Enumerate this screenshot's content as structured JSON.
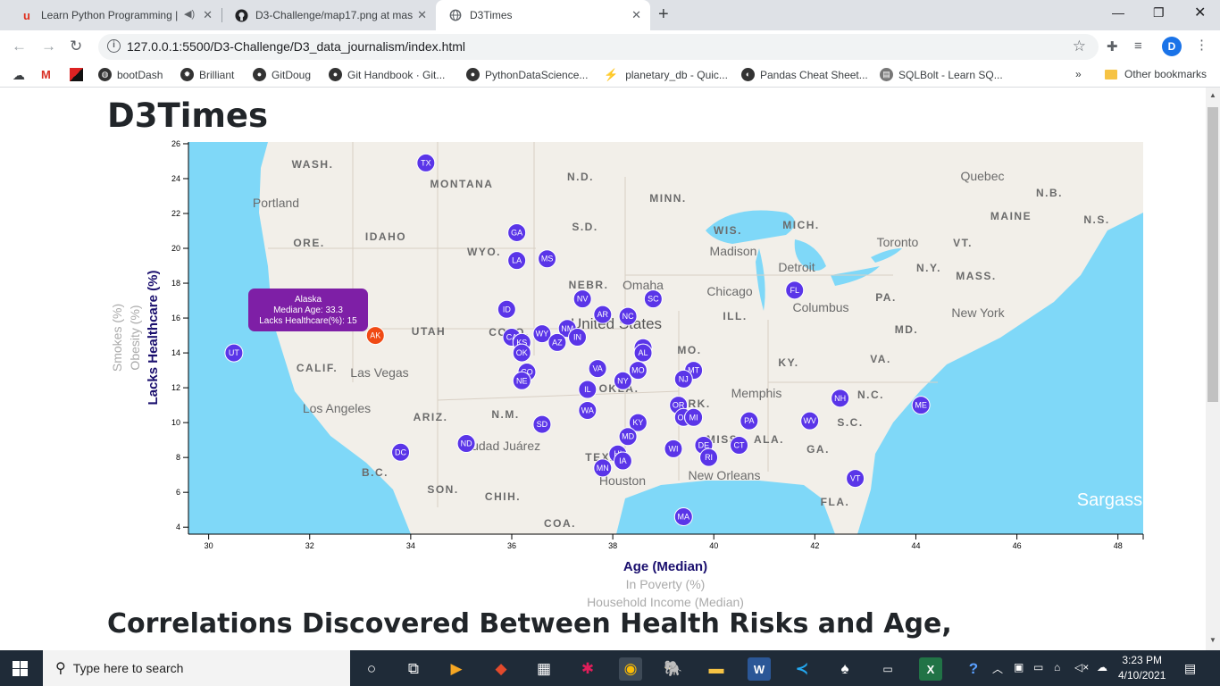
{
  "browser": {
    "tabs": [
      {
        "title": "Learn Python Programming |",
        "icon": "udemy-icon",
        "active": false
      },
      {
        "title": "D3-Challenge/map17.png at mas",
        "icon": "github-icon",
        "active": false
      },
      {
        "title": "D3Times",
        "icon": "globe-icon",
        "active": true
      }
    ],
    "url": "127.0.0.1:5500/D3-Challenge/D3_data_journalism/index.html",
    "profile_initial": "D",
    "bookmarks": [
      "bootDash",
      "Brilliant",
      "GitDoug",
      "Git Handbook · Git...",
      "PythonDataScience...",
      "planetary_db - Quic...",
      "Pandas Cheat Sheet...",
      "SQLBolt - Learn SQ..."
    ],
    "other_bookmarks": "Other bookmarks"
  },
  "page": {
    "title": "D3Times",
    "section_heading": "Correlations Discovered Between Health Risks and Age,"
  },
  "chart_data": {
    "type": "scatter",
    "xlabels": {
      "active": "Age (Median)",
      "inactive": [
        "In Poverty (%)",
        "Household Income (Median)"
      ]
    },
    "ylabels": {
      "active": "Lacks Healthcare (%)",
      "inactive": [
        "Obesity (%)",
        "Smokes (%)"
      ]
    },
    "xlim": [
      29.6,
      48.5
    ],
    "ylim": [
      3.6,
      26.1
    ],
    "xticks": [
      30,
      32,
      34,
      36,
      38,
      40,
      42,
      44,
      46,
      48
    ],
    "yticks": [
      4,
      6,
      8,
      10,
      12,
      14,
      16,
      18,
      20,
      22,
      24,
      26
    ],
    "colors": {
      "point": "#5a35e8",
      "highlight": "#f04a14",
      "tooltip": "#7e1fa6",
      "active_label": "#1a0f6e",
      "inactive_label": "#aaaaaa"
    },
    "points": [
      {
        "abbr": "TX",
        "x": 34.3,
        "y": 24.9
      },
      {
        "abbr": "GA",
        "x": 36.1,
        "y": 20.9
      },
      {
        "abbr": "LA",
        "x": 36.1,
        "y": 19.3
      },
      {
        "abbr": "MS",
        "x": 36.7,
        "y": 19.4
      },
      {
        "abbr": "NV",
        "x": 37.4,
        "y": 17.1
      },
      {
        "abbr": "SC",
        "x": 38.8,
        "y": 17.1
      },
      {
        "abbr": "FL",
        "x": 41.6,
        "y": 17.6
      },
      {
        "abbr": "ID",
        "x": 35.9,
        "y": 16.5
      },
      {
        "abbr": "AR",
        "x": 37.8,
        "y": 16.2
      },
      {
        "abbr": "NC",
        "x": 38.3,
        "y": 16.1
      },
      {
        "abbr": "NM",
        "x": 37.1,
        "y": 15.4
      },
      {
        "abbr": "IN",
        "x": 37.3,
        "y": 14.9
      },
      {
        "abbr": "WY",
        "x": 36.6,
        "y": 15.1
      },
      {
        "abbr": "CA",
        "x": 36.0,
        "y": 14.9
      },
      {
        "abbr": "KS",
        "x": 36.2,
        "y": 14.6
      },
      {
        "abbr": "OK",
        "x": 36.2,
        "y": 14.0
      },
      {
        "abbr": "AZ",
        "x": 36.9,
        "y": 14.6
      },
      {
        "abbr": "TN",
        "x": 38.6,
        "y": 14.3
      },
      {
        "abbr": "AL",
        "x": 38.6,
        "y": 14.0
      },
      {
        "abbr": "UT",
        "x": 30.5,
        "y": 14.0
      },
      {
        "abbr": "AK",
        "x": 33.3,
        "y": 15.0,
        "highlight": true
      },
      {
        "abbr": "VA",
        "x": 37.7,
        "y": 13.1
      },
      {
        "abbr": "MO",
        "x": 38.5,
        "y": 13.0
      },
      {
        "abbr": "MT",
        "x": 39.6,
        "y": 13.0
      },
      {
        "abbr": "NJ",
        "x": 39.4,
        "y": 12.5
      },
      {
        "abbr": "CO",
        "x": 36.3,
        "y": 12.9
      },
      {
        "abbr": "NE",
        "x": 36.2,
        "y": 12.4
      },
      {
        "abbr": "NY",
        "x": 38.2,
        "y": 12.4
      },
      {
        "abbr": "IL",
        "x": 37.5,
        "y": 11.9
      },
      {
        "abbr": "NH",
        "x": 42.5,
        "y": 11.4
      },
      {
        "abbr": "ME",
        "x": 44.1,
        "y": 11.0
      },
      {
        "abbr": "OR",
        "x": 39.3,
        "y": 11.0
      },
      {
        "abbr": "WA",
        "x": 37.5,
        "y": 10.7
      },
      {
        "abbr": "OH",
        "x": 39.4,
        "y": 10.3
      },
      {
        "abbr": "MI",
        "x": 39.6,
        "y": 10.3
      },
      {
        "abbr": "PA",
        "x": 40.7,
        "y": 10.1
      },
      {
        "abbr": "WV",
        "x": 41.9,
        "y": 10.1
      },
      {
        "abbr": "SD",
        "x": 36.6,
        "y": 9.9
      },
      {
        "abbr": "KY",
        "x": 38.5,
        "y": 10.0
      },
      {
        "abbr": "MD",
        "x": 38.3,
        "y": 9.2
      },
      {
        "abbr": "ND",
        "x": 35.1,
        "y": 8.8
      },
      {
        "abbr": "CT",
        "x": 40.5,
        "y": 8.7
      },
      {
        "abbr": "DE",
        "x": 39.8,
        "y": 8.7
      },
      {
        "abbr": "WI",
        "x": 39.2,
        "y": 8.5
      },
      {
        "abbr": "DC",
        "x": 33.8,
        "y": 8.3
      },
      {
        "abbr": "HI",
        "x": 38.1,
        "y": 8.2
      },
      {
        "abbr": "IA",
        "x": 38.2,
        "y": 7.8
      },
      {
        "abbr": "RI",
        "x": 39.9,
        "y": 8.0
      },
      {
        "abbr": "MN",
        "x": 37.8,
        "y": 7.4
      },
      {
        "abbr": "VT",
        "x": 42.8,
        "y": 6.8
      },
      {
        "abbr": "MA",
        "x": 39.4,
        "y": 4.6
      }
    ],
    "tooltip": {
      "state": "Alaska",
      "age_line": "Median Age: 33.3",
      "healthcare_line": "Lacks Healthcare(%): 15"
    }
  },
  "map_labels": [
    "WASH.",
    "MONTANA",
    "N.D.",
    "MINN.",
    "Quebec",
    "N.B.",
    "Portland",
    "MAINE",
    "N.S.",
    "ORE.",
    "IDAHO",
    "S.D.",
    "WIS.",
    "MICH.",
    "Toronto",
    "VT.",
    "WYO.",
    "Madison",
    "Detroit",
    "N.Y.",
    "MASS.",
    "NEBR.",
    "Omaha",
    "Chicago",
    "PA.",
    "Columbus",
    "New York",
    "ILL.",
    "United States",
    "UTAH",
    "COLO.",
    "MO.",
    "MD.",
    "CALIF.",
    "Las Vegas",
    "KY.",
    "VA.",
    "OKLA.",
    "Memphis",
    "N.C.",
    "Los Angeles",
    "ARIZ.",
    "N.M.",
    "ARK.",
    "S.C.",
    "Ciudad Juárez",
    "MISS.",
    "ALA.",
    "GA.",
    "TEXAS",
    "B.C.",
    "SON.",
    "Houston",
    "New Orleans",
    "CHIH.",
    "FLA.",
    "COA.",
    "Sargasso"
  ],
  "taskbar": {
    "search_placeholder": "Type here to search",
    "time": "3:23 PM",
    "date": "4/10/2021"
  }
}
